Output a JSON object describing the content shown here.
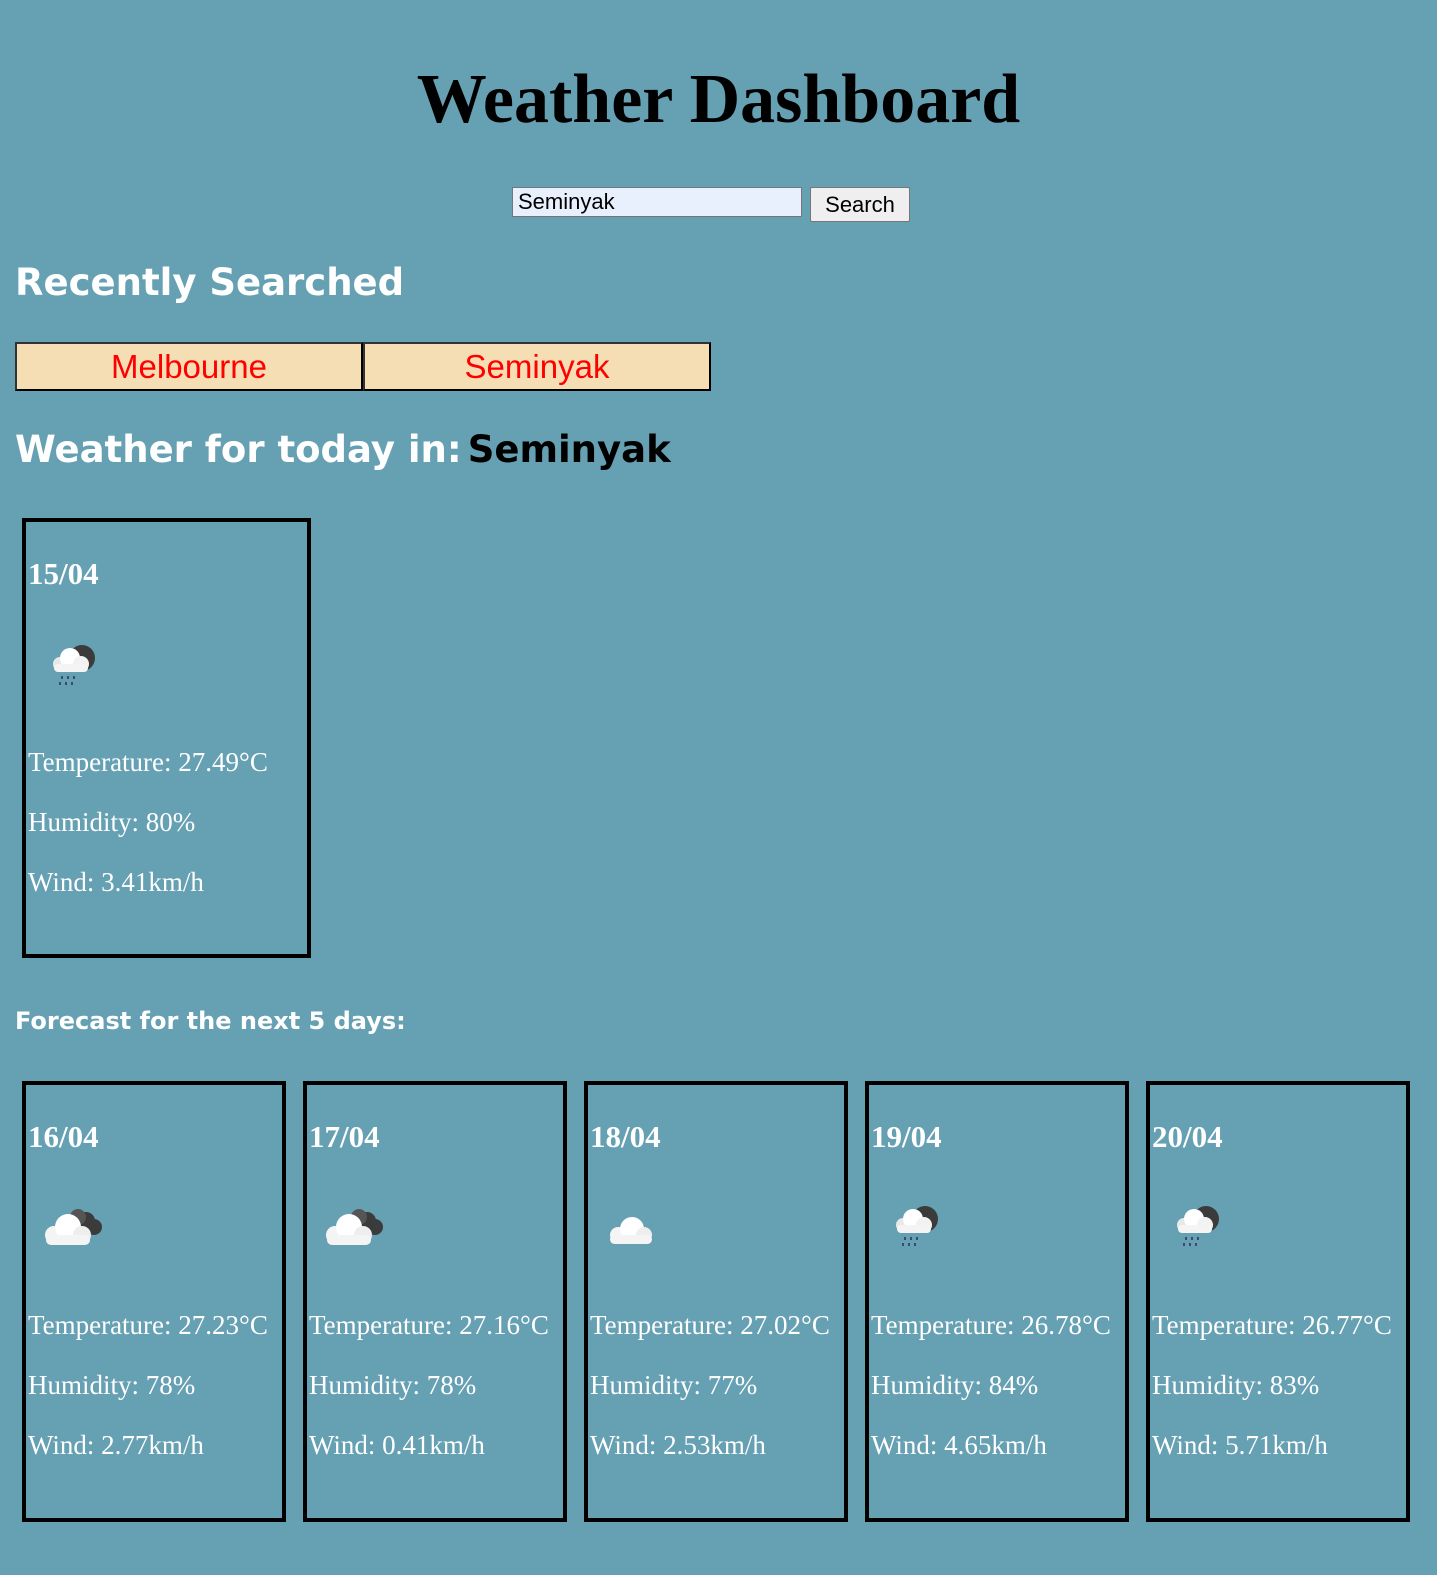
{
  "header": {
    "title": "Weather Dashboard"
  },
  "search": {
    "value": "Seminyak",
    "button_label": "Search"
  },
  "recent": {
    "heading": "Recently Searched",
    "items": [
      "Melbourne",
      "Seminyak"
    ]
  },
  "today": {
    "label": "Weather for today in:",
    "city": "Seminyak",
    "date": "15/04",
    "icon": "rain-cloud-icon",
    "temperature": "Temperature: 27.49°C",
    "humidity": "Humidity: 80%",
    "wind": "Wind: 3.41km/h"
  },
  "forecast": {
    "heading": "Forecast for the next 5 days:",
    "days": [
      {
        "date": "16/04",
        "icon": "broken-clouds-icon",
        "temperature": "Temperature: 27.23°C",
        "humidity": "Humidity: 78%",
        "wind": "Wind: 2.77km/h"
      },
      {
        "date": "17/04",
        "icon": "broken-clouds-icon",
        "temperature": "Temperature: 27.16°C",
        "humidity": "Humidity: 78%",
        "wind": "Wind: 0.41km/h"
      },
      {
        "date": "18/04",
        "icon": "cloud-icon",
        "temperature": "Temperature: 27.02°C",
        "humidity": "Humidity: 77%",
        "wind": "Wind: 2.53km/h"
      },
      {
        "date": "19/04",
        "icon": "rain-cloud-icon",
        "temperature": "Temperature: 26.78°C",
        "humidity": "Humidity: 84%",
        "wind": "Wind: 4.65km/h"
      },
      {
        "date": "20/04",
        "icon": "rain-cloud-icon",
        "temperature": "Temperature: 26.77°C",
        "humidity": "Humidity: 83%",
        "wind": "Wind: 5.71km/h"
      }
    ]
  }
}
